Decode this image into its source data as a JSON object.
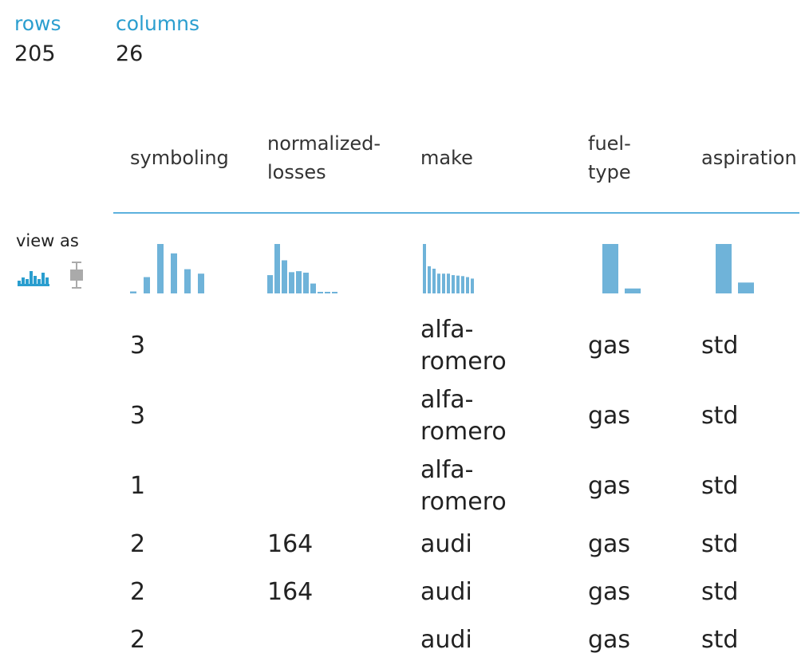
{
  "summary": {
    "rows_label": "rows",
    "rows_value": "205",
    "columns_label": "columns",
    "columns_value": "26"
  },
  "columns": [
    {
      "label_line1": "symboling",
      "label_line2": ""
    },
    {
      "label_line1": "normalized-",
      "label_line2": "losses"
    },
    {
      "label_line1": "make",
      "label_line2": ""
    },
    {
      "label_line1": "fuel-",
      "label_line2": "type"
    },
    {
      "label_line1": "aspiration",
      "label_line2": ""
    }
  ],
  "view_as": {
    "label": "view as",
    "options": [
      "histogram-icon",
      "boxplot-icon"
    ],
    "selected": "histogram-icon"
  },
  "colors": {
    "accent": "#2a9ecf",
    "divider": "#5cb1dd",
    "bar": "#6fb3d9",
    "text": "#222222",
    "inactive_icon": "#aaaaaa"
  },
  "histograms": [
    {
      "column": "symboling",
      "values": [
        0.04,
        0.33,
        1.0,
        0.81,
        0.49,
        0.4
      ]
    },
    {
      "column": "normalized-losses",
      "values": [
        0.37,
        1.0,
        0.67,
        0.43,
        0.45,
        0.42,
        0.2,
        0.0,
        0.02,
        0.02
      ]
    },
    {
      "column": "make",
      "values": [
        1.0,
        0.55,
        0.5,
        0.4,
        0.4,
        0.4,
        0.37,
        0.36,
        0.35,
        0.33,
        0.3
      ]
    },
    {
      "column": "fuel-type",
      "values": [
        1.0,
        0.1
      ]
    },
    {
      "column": "aspiration",
      "values": [
        1.0,
        0.22
      ]
    }
  ],
  "rows": [
    [
      "3",
      "",
      "alfa-\nromero",
      "gas",
      "std"
    ],
    [
      "3",
      "",
      "alfa-\nromero",
      "gas",
      "std"
    ],
    [
      "1",
      "",
      "alfa-\nromero",
      "gas",
      "std"
    ],
    [
      "2",
      "164",
      "audi",
      "gas",
      "std"
    ],
    [
      "2",
      "164",
      "audi",
      "gas",
      "std"
    ],
    [
      "2",
      "",
      "audi",
      "gas",
      "std"
    ]
  ]
}
